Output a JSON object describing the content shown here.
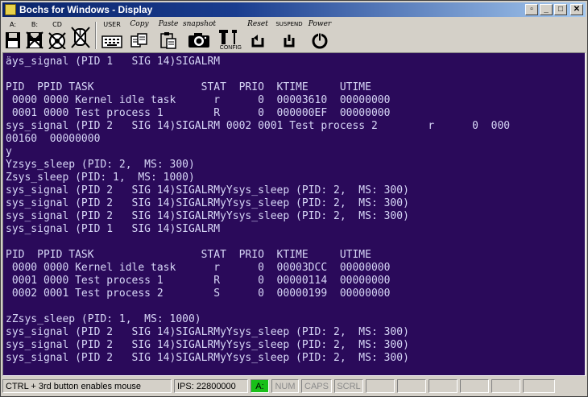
{
  "window": {
    "title": "Bochs for Windows - Display"
  },
  "toolbar": {
    "floppy_a": "A:",
    "floppy_b": "B:",
    "cdrom": "CD",
    "user": "USER",
    "copy": "Copy",
    "paste": "Paste",
    "snapshot": "snapshot",
    "config": "CONFIG",
    "reset": "Reset",
    "suspend": "SUSPEND",
    "power": "Power"
  },
  "console": {
    "lines": [
      "äys_signal (PID 1   SIG 14)SIGALRM",
      "",
      "PID  PPID TASK                 STAT  PRIO  KTIME     UTIME",
      " 0000 0000 Kernel idle task      r      0  00003610  00000000",
      " 0001 0000 Test process 1        R      0  000000EF  00000000",
      "sys_signal (PID 2   SIG 14)SIGALRM 0002 0001 Test process 2        r      0  000",
      "00160  00000000",
      "y",
      "Yzsys_sleep (PID: 2,  MS: 300)",
      "Zsys_sleep (PID: 1,  MS: 1000)",
      "sys_signal (PID 2   SIG 14)SIGALRMyYsys_sleep (PID: 2,  MS: 300)",
      "sys_signal (PID 2   SIG 14)SIGALRMyYsys_sleep (PID: 2,  MS: 300)",
      "sys_signal (PID 2   SIG 14)SIGALRMyYsys_sleep (PID: 2,  MS: 300)",
      "sys_signal (PID 1   SIG 14)SIGALRM",
      "",
      "PID  PPID TASK                 STAT  PRIO  KTIME     UTIME",
      " 0000 0000 Kernel idle task      r      0  00003DCC  00000000",
      " 0001 0000 Test process 1        R      0  00000114  00000000",
      " 0002 0001 Test process 2        S      0  00000199  00000000",
      "",
      "zZsys_sleep (PID: 1,  MS: 1000)",
      "sys_signal (PID 2   SIG 14)SIGALRMyYsys_sleep (PID: 2,  MS: 300)",
      "sys_signal (PID 2   SIG 14)SIGALRMyYsys_sleep (PID: 2,  MS: 300)",
      "sys_signal (PID 2   SIG 14)SIGALRMyYsys_sleep (PID: 2,  MS: 300)"
    ]
  },
  "statusbar": {
    "hint": "CTRL + 3rd button enables mouse",
    "ips": "IPS:  22800000",
    "drive": "A:",
    "num": "NUM",
    "caps": "CAPS",
    "scrl": "SCRL"
  },
  "colors": {
    "screen_bg": "#2a0a5a",
    "screen_fg": "#d7d7f7",
    "titlebar": "#0a246a",
    "led": "#18c018"
  }
}
